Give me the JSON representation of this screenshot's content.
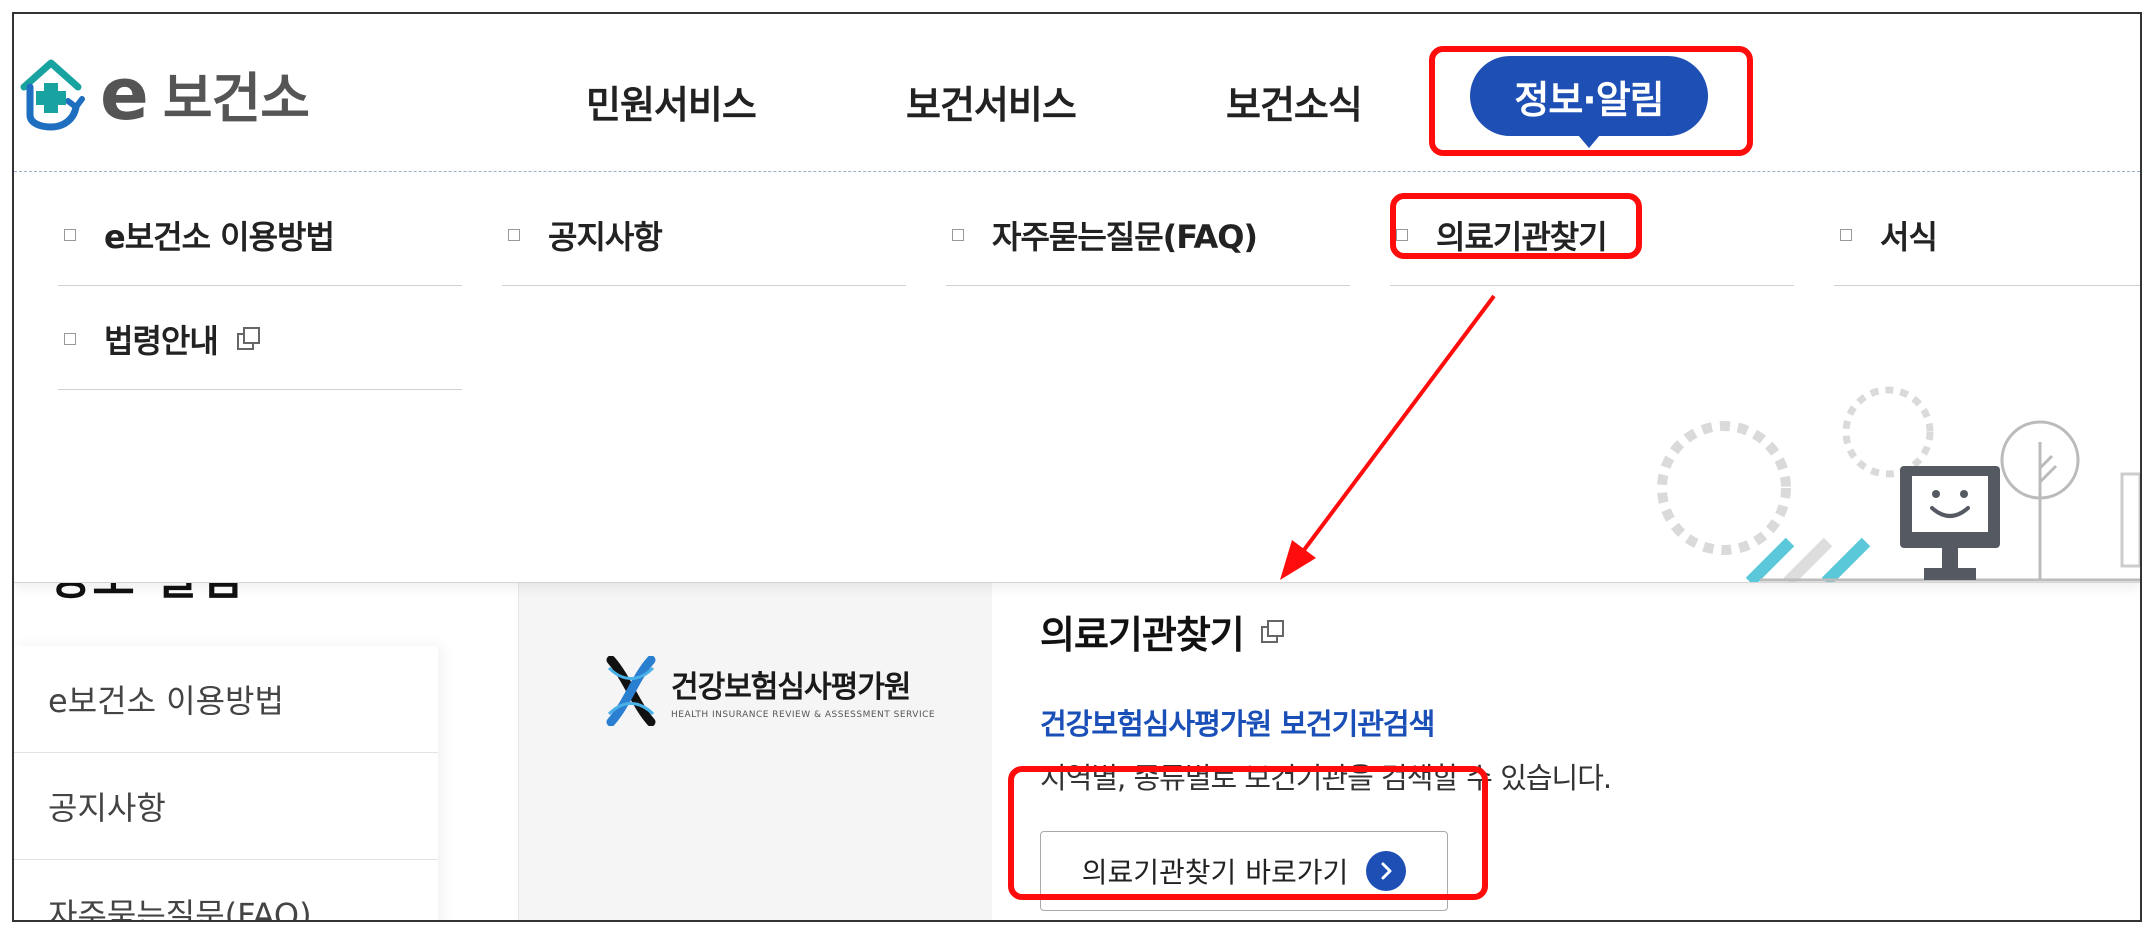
{
  "header": {
    "logo_e": "e",
    "logo_text": "보건소",
    "nav": [
      "민원서비스",
      "보건서비스",
      "보건소식"
    ],
    "nav_active": "정보·알림"
  },
  "mega_menu": {
    "items": [
      {
        "label": "e보건소 이용방법",
        "new_window": false
      },
      {
        "label": "공지사항",
        "new_window": false
      },
      {
        "label": "자주묻는질문(FAQ)",
        "new_window": false
      },
      {
        "label": "의료기관찾기",
        "new_window": false
      },
      {
        "label": "서식",
        "new_window": false
      },
      {
        "label": "법령안내",
        "new_window": true
      }
    ]
  },
  "page": {
    "heading": "정보·알림",
    "sidebar": [
      "e보건소 이용방법",
      "공지사항",
      "자주묻는질문(FAQ)"
    ],
    "org_logo": {
      "name": "건강보험심사평가원",
      "subtitle": "HEALTH INSURANCE REVIEW & ASSESSMENT SERVICE"
    },
    "card": {
      "title": "의료기관찾기",
      "link_text": "건강보험심사평가원 보건기관검색",
      "description": "지역별, 종류별로 보건기관을 검색할 수 있습니다.",
      "button_label": "의료기관찾기 바로가기"
    }
  },
  "colors": {
    "brand_blue": "#1d4fb5",
    "link_blue": "#1a4fb8",
    "annotation_red": "#ff0d0d",
    "logo_teal": "#19a3a0",
    "logo_blue": "#1e6fc0"
  }
}
